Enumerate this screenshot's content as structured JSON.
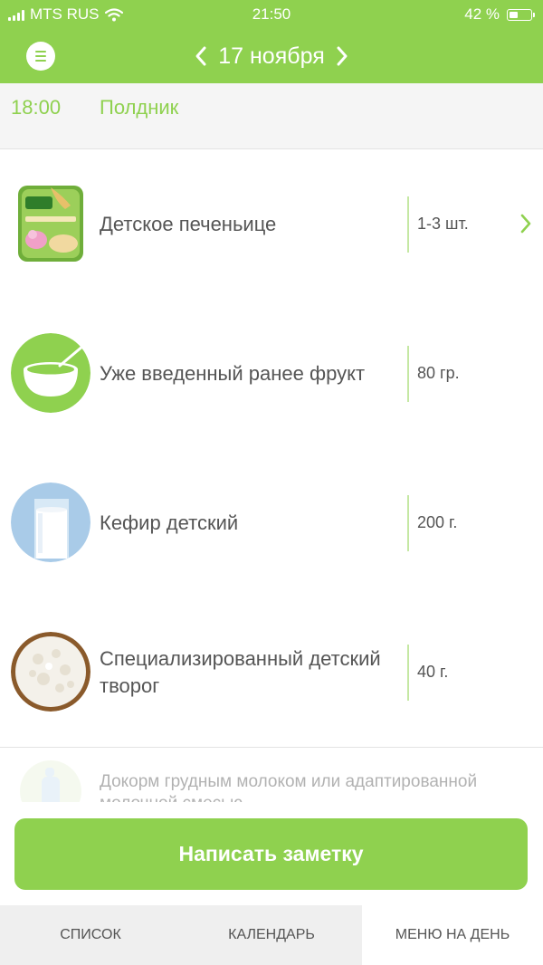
{
  "status_bar": {
    "carrier": "MTS RUS",
    "time": "21:50",
    "battery_text": "42 %",
    "battery_level": 0.42
  },
  "header": {
    "date": "17 ноября"
  },
  "meal": {
    "time": "18:00",
    "name": "Полдник"
  },
  "items": [
    {
      "name": "Детское печеньице",
      "amount": "1-3 шт.",
      "icon": "cookie-box-icon"
    },
    {
      "name": "Уже введенный ранее фрукт",
      "amount": "80 гр.",
      "icon": "bowl-icon"
    },
    {
      "name": "Кефир детский",
      "amount": "200 г.",
      "icon": "kefir-glass-icon"
    },
    {
      "name": "Специализированный детский творог",
      "amount": "40 г.",
      "icon": "cottage-cheese-icon"
    }
  ],
  "partial_item": {
    "name": "Докорм грудным молоком или адаптированной молочной смесью",
    "icon": "baby-bottle-icon"
  },
  "note_button": "Написать заметку",
  "tabs": [
    {
      "label": "Список"
    },
    {
      "label": "Календарь"
    },
    {
      "label": "Меню на день"
    }
  ],
  "colors": {
    "accent": "#8fd14f",
    "divider": "#e3e3e3",
    "text": "#555555"
  }
}
